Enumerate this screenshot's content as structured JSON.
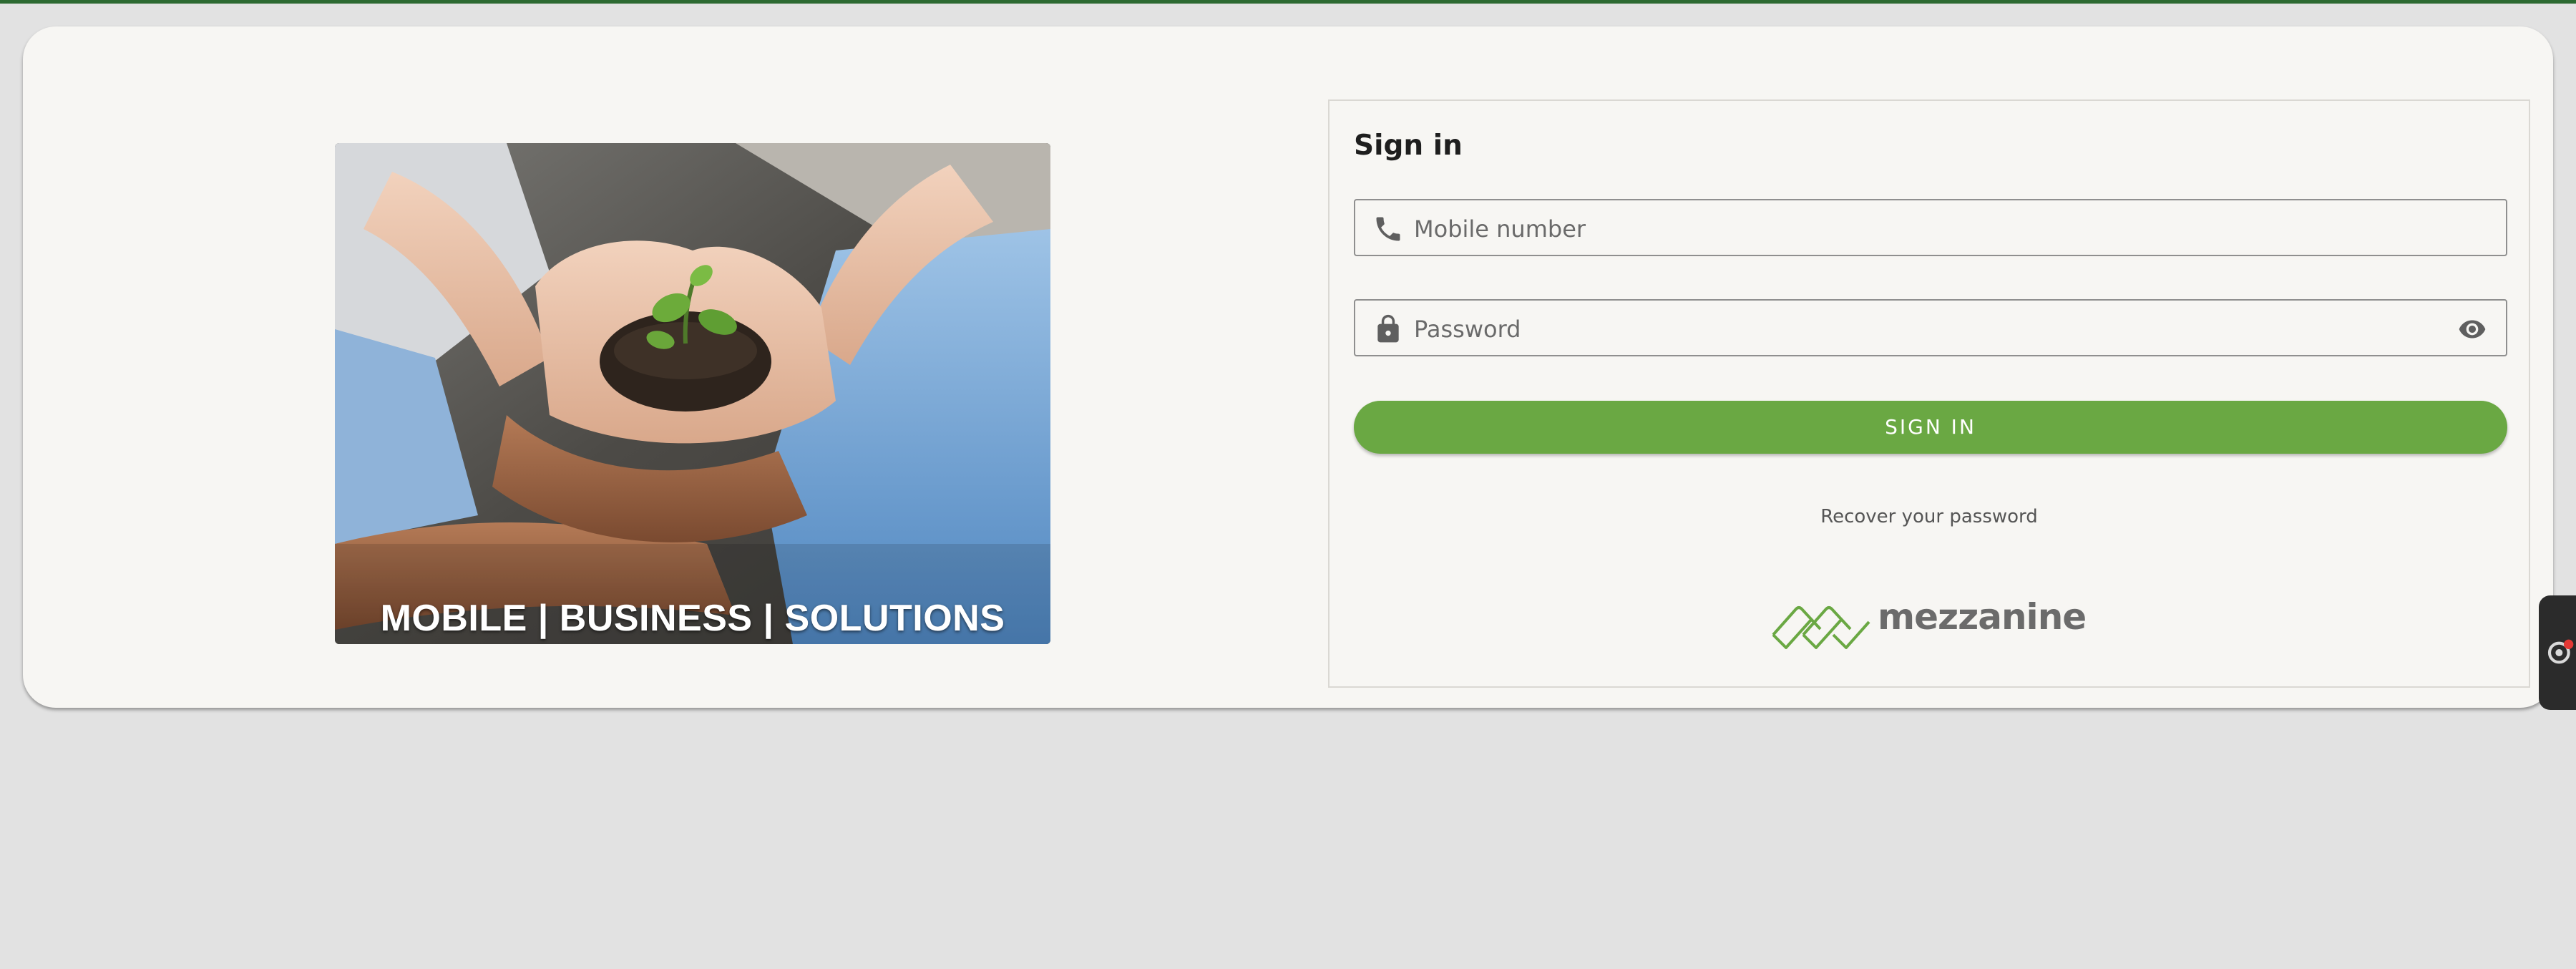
{
  "hero": {
    "caption": "MOBILE | BUSINESS | SOLUTIONS"
  },
  "signin": {
    "title": "Sign in",
    "mobile_placeholder": "Mobile number",
    "password_placeholder": "Password",
    "submit_label": "SIGN IN",
    "recover_link": "Recover your password"
  },
  "brand": {
    "name": "mezzanine"
  },
  "icons": {
    "mobile_field": "phone-icon",
    "password_field": "lock-icon",
    "password_toggle": "eye-icon",
    "side_widget": "support-widget-icon"
  },
  "colors": {
    "accent_green": "#6aa843",
    "top_strip": "#2d6a32",
    "card_background": "#f7f6f3",
    "page_background": "#e2e2e2"
  }
}
